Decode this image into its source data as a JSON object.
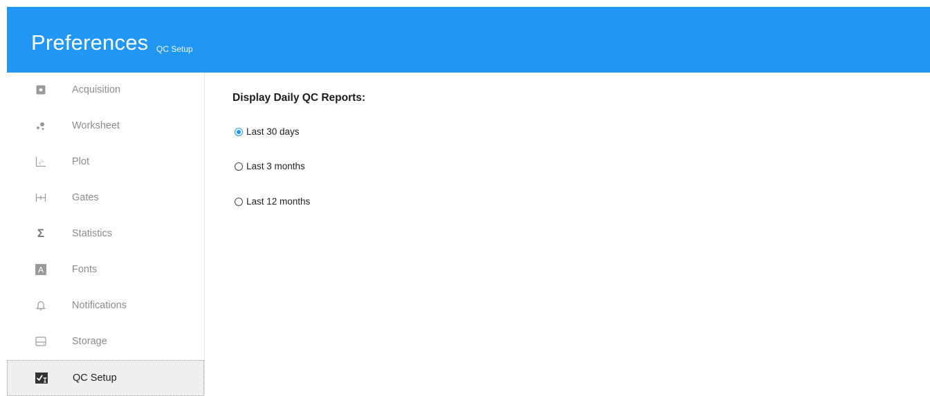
{
  "header": {
    "title": "Preferences",
    "subtitle": "QC Setup",
    "color": "#2196f3"
  },
  "sidebar": {
    "items": [
      {
        "label": "Acquisition",
        "icon": "acquisition-icon"
      },
      {
        "label": "Worksheet",
        "icon": "worksheet-icon"
      },
      {
        "label": "Plot",
        "icon": "plot-icon"
      },
      {
        "label": "Gates",
        "icon": "gates-icon"
      },
      {
        "label": "Statistics",
        "icon": "sigma-icon"
      },
      {
        "label": "Fonts",
        "icon": "font-icon"
      },
      {
        "label": "Notifications",
        "icon": "bell-icon"
      },
      {
        "label": "Storage",
        "icon": "storage-icon"
      },
      {
        "label": "QC Setup",
        "icon": "qc-setup-icon",
        "active": true
      }
    ]
  },
  "main": {
    "section_title": "Display Daily QC Reports:",
    "options": [
      {
        "label": "Last 30 days",
        "selected": true
      },
      {
        "label": "Last 3 months",
        "selected": false
      },
      {
        "label": "Last 12 months",
        "selected": false
      }
    ]
  }
}
